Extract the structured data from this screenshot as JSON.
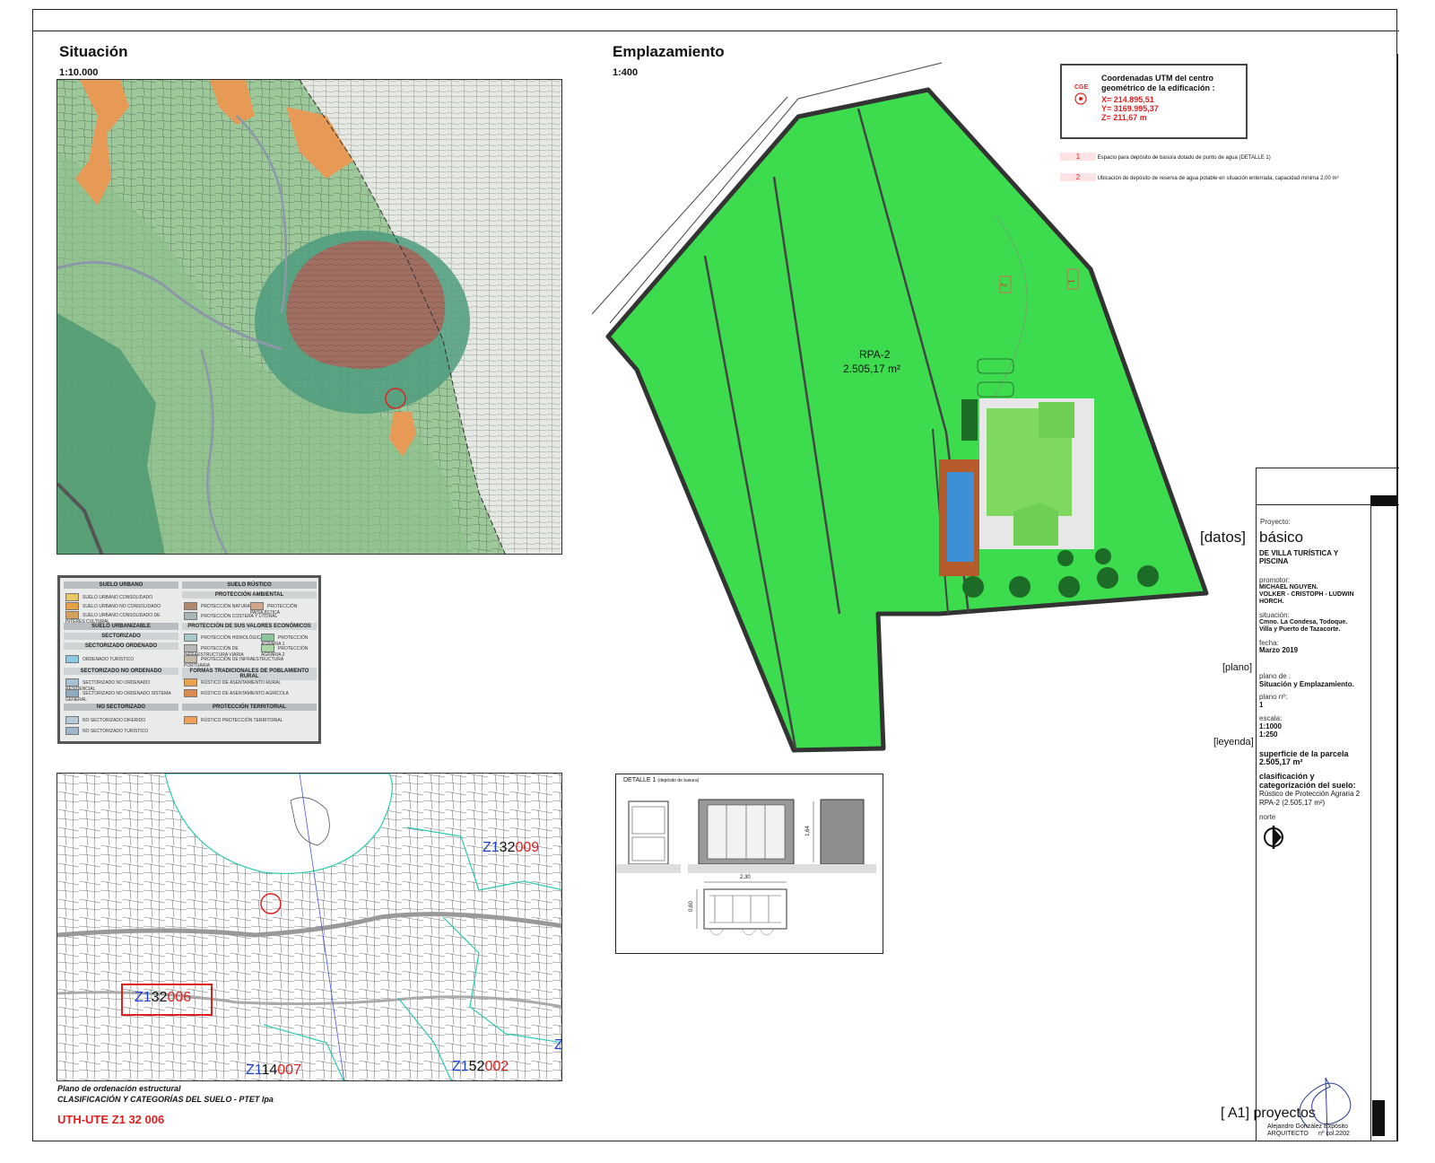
{
  "situacion": {
    "title": "Situación",
    "scale": "1:10.000"
  },
  "emplazamiento": {
    "title": "Emplazamiento",
    "scale": "1:400"
  },
  "cge": {
    "badge": "CGE",
    "heading1": "Coordenadas UTM  del centro",
    "heading2": "geométrico de la edificación :",
    "x": "X= 214.895,51",
    "y": "Y= 3169.995,37",
    "z": "Z= 211,67 m"
  },
  "notes": [
    {
      "num": "1",
      "text": "Espacio para depósito de basura dotado de punto de agua (DETALLE 1)"
    },
    {
      "num": "2",
      "text": "Ubicación de depósito de reserva de agua potable en situación enterrada, capacidad mínima 2,00 m³"
    }
  ],
  "parcel": {
    "zone": "RPA-2",
    "area": "2.505,17 m²",
    "mark1": "1",
    "mark2": "2"
  },
  "legend": {
    "suelo_urbano": "SUELO URBANO",
    "suelo_rustico": "SUELO RÚSTICO",
    "urbano_rows": [
      {
        "code": "SUC",
        "label": "SUELO URBANO CONSOLIDADO",
        "color": "#e8c766"
      },
      {
        "code": "SUNC",
        "label": "SUELO URBANO NO CONSOLIDADO",
        "color": "#e6a04a"
      },
      {
        "code": "SUCI",
        "label": "SUELO URBANO CONSOLIDADO DE INTERÉS CULTURAL",
        "color": "#d9a05a"
      }
    ],
    "proteccion_ambiental": "PROTECCIÓN AMBIENTAL",
    "ambiental_rows": [
      {
        "code": "RPN",
        "label": "PROTECCIÓN NATURAL",
        "color": "#b0896c"
      },
      {
        "code": "RPP",
        "label": "PROTECCIÓN PAISAJÍSTICA",
        "color": "#cfa58c"
      },
      {
        "code": "RPL",
        "label": "PROTECCIÓN COSTERA Y LITORAL",
        "color": "#a7b4b8"
      }
    ],
    "suelo_urbanizable": "SUELO URBANIZABLE",
    "proteccion_economicos": "PROTECCIÓN DE SUS VALORES ECONÓMICOS",
    "sectorizado": "SECTORIZADO",
    "sectorizado_ordenado": "SECTORIZADO ORDENADO",
    "economicos_rows": [
      {
        "code": "RPH",
        "label": "PROTECCIÓN HIDROLÓGICA",
        "color": "#a9c9c9"
      },
      {
        "code": "RPA-1",
        "label": "PROTECCIÓN AGRARIA 1",
        "color": "#8bc79a"
      },
      {
        "code": "RPV",
        "label": "PROTECCIÓN DE INFRAESTRUCTURA VIARIA",
        "color": "#b7b7b7"
      },
      {
        "code": "RPA-2",
        "label": "PROTECCIÓN AGRARIA 2",
        "color": "#a9d7a6"
      },
      {
        "code": "RPIP",
        "label": "PROTECCIÓN DE INFRAESTRUCTURA PORTUARIA",
        "color": "#c3bba8"
      }
    ],
    "ordenado_row": {
      "code": "SOT",
      "label": "ORDENADO TURÍSTICO",
      "color": "#8cc8e0"
    },
    "sectorizado_no_ordenado": "SECTORIZADO NO ORDENADO",
    "formas_tradicionales": "FORMAS TRADICIONALES DE POBLAMIENTO RURAL",
    "no_ordenado_rows": [
      {
        "code": "SNR",
        "label": "SECTORIZADO NO ORDENADO RESIDENCIAL",
        "color": "#a8c0cf"
      },
      {
        "code": "SNOG",
        "label": "SECTORIZADO NO ORDENADO SISTEMA GENERAL",
        "color": "#8fa9bd"
      }
    ],
    "formas_rows": [
      {
        "code": "RAR",
        "label": "RÚSTICO DE ASENTAMIENTO RURAL",
        "color": "#e6a24e"
      },
      {
        "code": "RAA",
        "label": "RÚSTICO DE ASENTAMIENTO AGRÍCOLA",
        "color": "#d98a4e"
      }
    ],
    "no_sectorizado": "NO SECTORIZADO",
    "proteccion_territorial": "PROTECCIÓN TERRITORIAL",
    "no_sectorizado_rows": [
      {
        "code": "SND",
        "label": "NO SECTORIZADO DIFERIDO",
        "color": "#b8c9d6"
      },
      {
        "code": "SNT",
        "label": "NO SECTORIZADO TURÍSTICO",
        "color": "#9fb6c8"
      }
    ],
    "territorial_row": {
      "code": "RPT",
      "label": "RÚSTICO PROTECCIÓN TERRITORIAL",
      "color": "#f0a25a"
    }
  },
  "cadastral": {
    "label_009": {
      "p1": "Z1",
      "p2": "32",
      "p3": "009"
    },
    "label_006": {
      "p1": "Z1",
      "p2": "32",
      "p3": "006"
    },
    "label_007": {
      "p1": "Z1",
      "p2": "14",
      "p3": "007"
    },
    "label_002": {
      "p1": "Z1",
      "p2": "52",
      "p3": "002"
    },
    "label_edge": "Z"
  },
  "plano_caption": {
    "line1": "Plano de ordenación estructural",
    "line2": "CLASIFICACIÓN Y CATEGORÍAS DEL SUELO - PTET lpa",
    "code": "UTH-UTE Z1 32 006"
  },
  "detalle": {
    "title": "DETALLE 1",
    "subtitle": "(depósito de basura)",
    "dim_h": "1,64",
    "dim_w": "2,30",
    "dim_d": "0,60"
  },
  "titleblock": {
    "proyecto_label": "Proyecto:",
    "datos_tag": "[datos]",
    "datos_value": "básico",
    "proyecto_name1": "DE VILLA TURÍSTICA Y",
    "proyecto_name2": "PISCINA",
    "promotor_label": "promotor:",
    "promotor1": "MICHAEL NGUYEN.",
    "promotor2": "VOLKER - CRISTOPH - LUDWIN",
    "promotor3": "HORCH.",
    "situacion_label": "situación:",
    "situacion1": "Cmno. La Condesa, Todoque.",
    "situacion2": "Villa y Puerto de Tazacorte.",
    "fecha_label": "fecha:",
    "fecha": "Marzo 2019",
    "plano_tag": "[plano]",
    "plano_de_label": "plano de :",
    "plano_de": "Situación y Emplazamiento.",
    "plano_n_label": "plano nº:",
    "plano_n": "1",
    "escala_label": "escala:",
    "escala1": "1:1000",
    "escala2": "1:250",
    "leyenda_tag": "[leyenda]",
    "superficie1": "superficie de la parcela",
    "superficie2": "2.505,17 m²",
    "clasif1": "clasificación y",
    "clasif2": "categorización del suelo:",
    "clasif3": "Rústico de Protección Agraria 2",
    "clasif4": "RPA-2 (2.505,17 m²)",
    "norte_label": "norte",
    "brand": "[ A1] proyectos",
    "architect1": "Alejandro González Expósito",
    "architect2": "ARQUITECTO",
    "colegiado": "nº col.2202"
  },
  "colors": {
    "parcel_green": "#3ddc4f",
    "zone_red": "#e02020",
    "code_blue": "#1a3fd6",
    "pool_blue": "#3d8fd6",
    "deck_brown": "#b55a2a"
  }
}
